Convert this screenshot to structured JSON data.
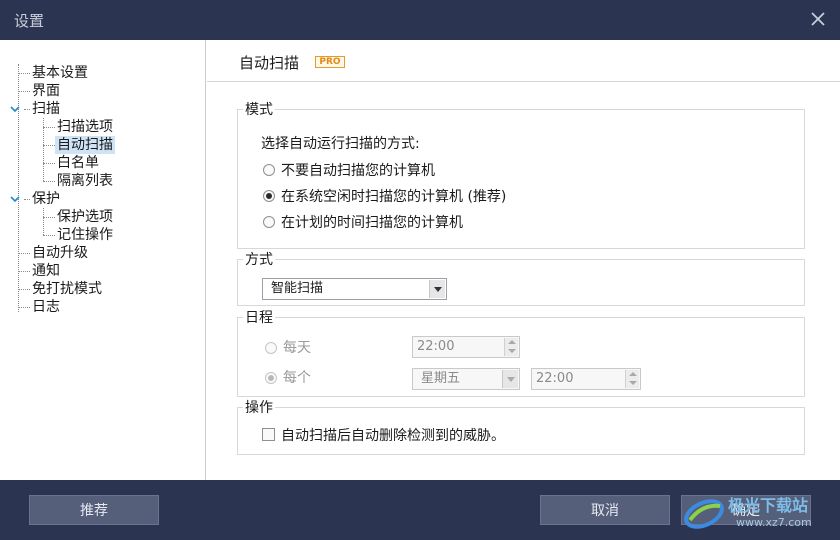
{
  "window": {
    "title": "设置"
  },
  "sidebar": {
    "items": [
      {
        "label": "基本设置"
      },
      {
        "label": "界面"
      },
      {
        "label": "扫描"
      },
      {
        "label": "扫描选项"
      },
      {
        "label": "自动扫描"
      },
      {
        "label": "白名单"
      },
      {
        "label": "隔离列表"
      },
      {
        "label": "保护"
      },
      {
        "label": "保护选项"
      },
      {
        "label": "记住操作"
      },
      {
        "label": "自动升级"
      },
      {
        "label": "通知"
      },
      {
        "label": "免打扰模式"
      },
      {
        "label": "日志"
      }
    ],
    "selected": "自动扫描"
  },
  "content": {
    "title": "自动扫描",
    "badge": "PRO",
    "mode": {
      "label": "模式",
      "prompt": "选择自动运行扫描的方式:",
      "options": [
        {
          "label": "不要自动扫描您的计算机",
          "checked": false
        },
        {
          "label": "在系统空闲时扫描您的计算机 (推荐)",
          "checked": true
        },
        {
          "label": "在计划的时间扫描您的计算机",
          "checked": false
        }
      ]
    },
    "method": {
      "label": "方式",
      "selected": "智能扫描"
    },
    "schedule": {
      "label": "日程",
      "daily": {
        "label": "每天",
        "time": "22:00"
      },
      "each": {
        "label": "每个",
        "day": "星期五",
        "time": "22:00"
      }
    },
    "action": {
      "label": "操作",
      "checkbox_label": "自动扫描后自动删除检测到的威胁。",
      "checked": false
    }
  },
  "footer": {
    "recommend_label": "推荐",
    "cancel_label": "取消",
    "ok_label": "确定",
    "watermark_text": "极光下载站",
    "watermark_url": "www.xz7.com"
  },
  "colors": {
    "titlebar": "#2b3450",
    "button": "#565f7a",
    "badge": "#e08a14",
    "selection": "#cfe3f7"
  }
}
